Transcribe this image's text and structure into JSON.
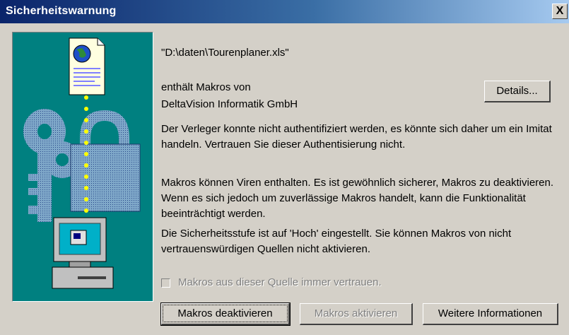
{
  "window": {
    "title": "Sicherheitswarnung",
    "close_label": "X"
  },
  "content": {
    "file_path": "\"D:\\daten\\Tourenplaner.xls\"",
    "contains_macros_from": "enthält Makros von",
    "publisher": "DeltaVision Informatik GmbH",
    "details_button": "Details...",
    "auth_warning": "Der Verleger konnte nicht authentifiziert werden, es könnte sich daher um ein Imitat handeln. Vertrauen Sie dieser Authentisierung nicht.",
    "virus_warning": "Makros können Viren enthalten. Es ist gewöhnlich sicherer, Makros zu deaktivieren. Wenn es sich jedoch um zuverlässige Makros handelt, kann die Funktionalität beeinträchtigt werden.",
    "security_level": "Die Sicherheitsstufe ist auf 'Hoch' eingestellt. Sie können Makros von nicht vertrauenswürdigen Quellen nicht aktivieren.",
    "trust_checkbox_label": "Makros aus dieser Quelle immer vertrauen.",
    "trust_checkbox_checked": false
  },
  "buttons": {
    "disable_macros": "Makros deaktivieren",
    "enable_macros": "Makros aktivieren",
    "more_info": "Weitere Informationen"
  },
  "colors": {
    "titlebar": "#0a246a",
    "illustration_bg": "#008080",
    "dialog_bg": "#d4d0c8"
  },
  "icons": [
    "document-globe-icon",
    "padlock-keys-icon",
    "computer-icon"
  ]
}
